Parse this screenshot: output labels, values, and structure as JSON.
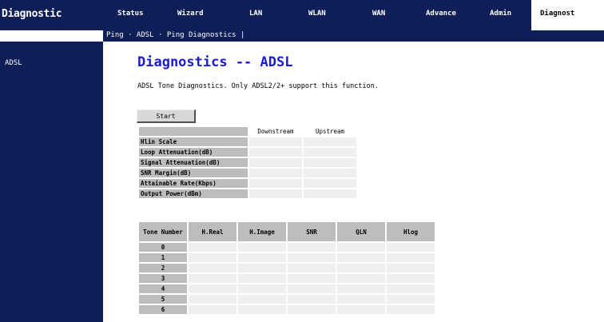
{
  "header": {
    "brand": "Diagnostic",
    "nav": [
      "Status",
      "Wizard",
      "LAN",
      "WLAN",
      "WAN",
      "Advance",
      "Admin"
    ],
    "active_tab": "Diagnost"
  },
  "subnav": {
    "label": "Ping · ADSL · Ping Diagnostics |"
  },
  "sidebar": {
    "item": "ADSL"
  },
  "main": {
    "title": "Diagnostics -- ADSL",
    "description": "ADSL Tone Diagnostics. Only ADSL2/2+ support this function.",
    "test_button": "Start"
  },
  "summary_table": {
    "columns": [
      "Downstream",
      "Upstream"
    ],
    "rows": [
      {
        "label": "Hlin Scale",
        "downstream": "",
        "upstream": ""
      },
      {
        "label": "Loop Attenuation(dB)",
        "downstream": "",
        "upstream": ""
      },
      {
        "label": "Signal Attenuation(dB)",
        "downstream": "",
        "upstream": ""
      },
      {
        "label": "SNR Margin(dB)",
        "downstream": "",
        "upstream": ""
      },
      {
        "label": "Attainable Rate(Kbps)",
        "downstream": "",
        "upstream": ""
      },
      {
        "label": "Output Power(dBm)",
        "downstream": "",
        "upstream": ""
      }
    ]
  },
  "tone_table": {
    "tone_header": "Tone Number",
    "columns": [
      "H.Real",
      "H.Image",
      "SNR",
      "QLN",
      "Hlog"
    ],
    "rows": [
      {
        "tone": "0",
        "values": [
          "",
          "",
          "",
          "",
          ""
        ]
      },
      {
        "tone": "1",
        "values": [
          "",
          "",
          "",
          "",
          ""
        ]
      },
      {
        "tone": "2",
        "values": [
          "",
          "",
          "",
          "",
          ""
        ]
      },
      {
        "tone": "3",
        "values": [
          "",
          "",
          "",
          "",
          ""
        ]
      },
      {
        "tone": "4",
        "values": [
          "",
          "",
          "",
          "",
          ""
        ]
      },
      {
        "tone": "5",
        "values": [
          "",
          "",
          "",
          "",
          ""
        ]
      },
      {
        "tone": "6",
        "values": [
          "",
          "",
          "",
          "",
          ""
        ]
      }
    ]
  },
  "colors": {
    "nav_background": "#0e1e56",
    "title_blue": "#1b1bd4",
    "header_cell": "#bdbdbd",
    "data_cell": "#efefef"
  }
}
